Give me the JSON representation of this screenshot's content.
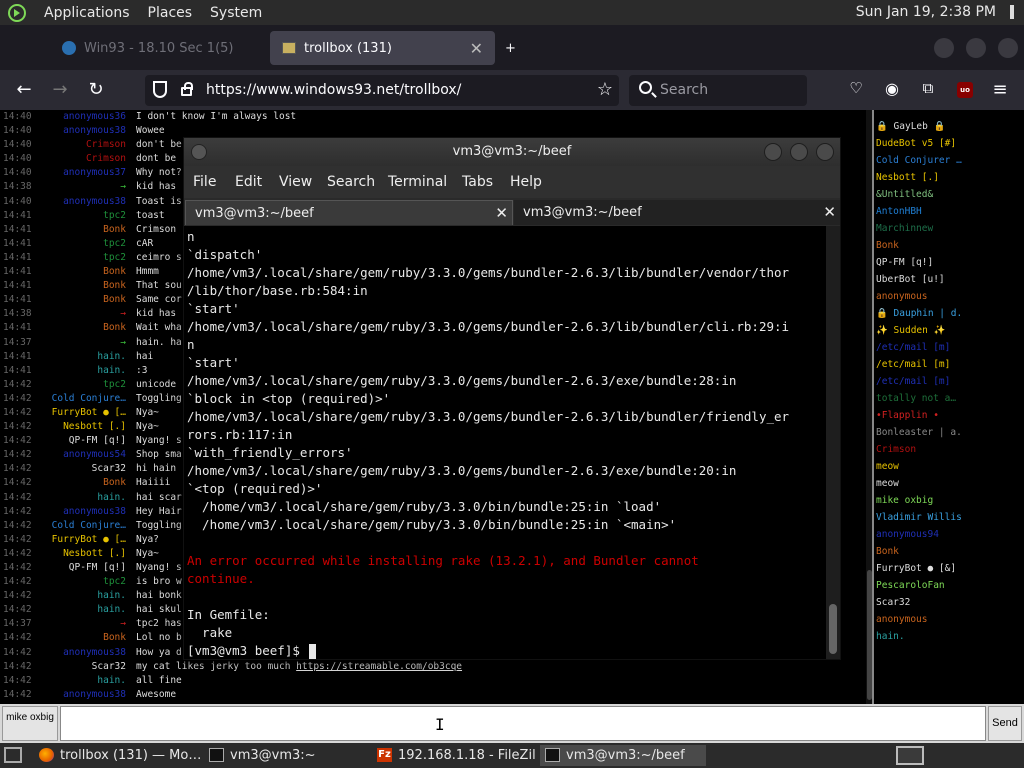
{
  "top_panel": {
    "menus": [
      "Applications",
      "Places",
      "System"
    ],
    "clock": "Sun Jan 19,  2:38 PM"
  },
  "browser": {
    "tabs": [
      {
        "label": "Win93 - 18.10 Sec 1(5)",
        "state": "inactive"
      },
      {
        "label": "trollbox (131)",
        "state": "active"
      }
    ],
    "url": "https://www.windows93.net/trollbox/",
    "search_placeholder": "Search",
    "ublock_label": "uo"
  },
  "chat": {
    "messages": [
      {
        "ts": "14:40",
        "nick": "anonymous36",
        "nick_color": "#1f2fb5",
        "msg": "I don't know I'm always lost"
      },
      {
        "ts": "14:40",
        "nick": "anonymous38",
        "nick_color": "#1f2fb5",
        "msg": "Wowee"
      },
      {
        "ts": "14:40",
        "nick": "Crimson",
        "nick_color": "#b01010",
        "msg": "don't be"
      },
      {
        "ts": "14:40",
        "nick": "Crimson",
        "nick_color": "#b01010",
        "msg": "dont be"
      },
      {
        "ts": "14:40",
        "nick": "anonymous37",
        "nick_color": "#1f2fb5",
        "msg": "Why not?"
      },
      {
        "ts": "14:38",
        "nick": "→",
        "nick_color": "#3cc23c",
        "msg": "kid has"
      },
      {
        "ts": "14:40",
        "nick": "anonymous38",
        "nick_color": "#1f2fb5",
        "msg": "Toast is"
      },
      {
        "ts": "14:41",
        "nick": "tpc2",
        "nick_color": "#1e8f3a",
        "msg": "toast"
      },
      {
        "ts": "14:41",
        "nick": "Bonk",
        "nick_color": "#c8641e",
        "msg": "Crimson"
      },
      {
        "ts": "14:41",
        "nick": "tpc2",
        "nick_color": "#1e8f3a",
        "msg": "cAR"
      },
      {
        "ts": "14:41",
        "nick": "tpc2",
        "nick_color": "#1e8f3a",
        "msg": "ceimro s"
      },
      {
        "ts": "14:41",
        "nick": "Bonk",
        "nick_color": "#c8641e",
        "msg": "Hmmm"
      },
      {
        "ts": "14:41",
        "nick": "Bonk",
        "nick_color": "#c8641e",
        "msg": "That sou"
      },
      {
        "ts": "14:41",
        "nick": "Bonk",
        "nick_color": "#c8641e",
        "msg": "Same cor"
      },
      {
        "ts": "14:38",
        "nick": "→",
        "nick_color": "#d02020",
        "msg": "kid has"
      },
      {
        "ts": "14:41",
        "nick": "Bonk",
        "nick_color": "#c8641e",
        "msg": "Wait wha"
      },
      {
        "ts": "14:37",
        "nick": "→",
        "nick_color": "#3cc23c",
        "msg": "hain. ha"
      },
      {
        "ts": "14:41",
        "nick": "hain.",
        "nick_color": "#2aa0a0",
        "msg": "hai"
      },
      {
        "ts": "14:41",
        "nick": "hain.",
        "nick_color": "#2aa0a0",
        "msg": ":3"
      },
      {
        "ts": "14:42",
        "nick": "tpc2",
        "nick_color": "#1e8f3a",
        "msg": "unicode"
      },
      {
        "ts": "14:42",
        "nick": "Cold Conjure…",
        "nick_color": "#2b7fd4",
        "msg": "Toggling"
      },
      {
        "ts": "14:42",
        "nick": "FurryBot ● […",
        "nick_color": "#e6c200",
        "msg": "Nya~"
      },
      {
        "ts": "14:42",
        "nick": "Nesbott [.]",
        "nick_color": "#e6c200",
        "msg": "Nya~"
      },
      {
        "ts": "14:42",
        "nick": "QP-FM [q!]",
        "nick_color": "#dddddd",
        "msg": "Nyang! s"
      },
      {
        "ts": "14:42",
        "nick": "anonymous54",
        "nick_color": "#1f2fb5",
        "msg": "Shop sma"
      },
      {
        "ts": "14:42",
        "nick": "Scar32",
        "nick_color": "#dddddd",
        "msg": "hi hain"
      },
      {
        "ts": "14:42",
        "nick": "Bonk",
        "nick_color": "#c8641e",
        "msg": "Haiiii"
      },
      {
        "ts": "14:42",
        "nick": "hain.",
        "nick_color": "#2aa0a0",
        "msg": "hai scar"
      },
      {
        "ts": "14:42",
        "nick": "anonymous38",
        "nick_color": "#1f2fb5",
        "msg": "Hey Hair"
      },
      {
        "ts": "14:42",
        "nick": "Cold Conjure…",
        "nick_color": "#2b7fd4",
        "msg": "Toggling"
      },
      {
        "ts": "14:42",
        "nick": "FurryBot ● […",
        "nick_color": "#e6c200",
        "msg": "Nya?"
      },
      {
        "ts": "14:42",
        "nick": "Nesbott [.]",
        "nick_color": "#e6c200",
        "msg": "Nya~"
      },
      {
        "ts": "14:42",
        "nick": "QP-FM [q!]",
        "nick_color": "#dddddd",
        "msg": "Nyang! s"
      },
      {
        "ts": "14:42",
        "nick": "tpc2",
        "nick_color": "#1e8f3a",
        "msg": "is bro w"
      },
      {
        "ts": "14:42",
        "nick": "hain.",
        "nick_color": "#2aa0a0",
        "msg": "hai bonk"
      },
      {
        "ts": "14:42",
        "nick": "hain.",
        "nick_color": "#2aa0a0",
        "msg": "hai skul"
      },
      {
        "ts": "14:37",
        "nick": "→",
        "nick_color": "#d02020",
        "msg": "tpc2 has"
      },
      {
        "ts": "14:42",
        "nick": "Bonk",
        "nick_color": "#c8641e",
        "msg": "Lol no b"
      },
      {
        "ts": "14:42",
        "nick": "anonymous38",
        "nick_color": "#1f2fb5",
        "msg": "How ya d"
      },
      {
        "ts": "14:42",
        "nick": "Scar32",
        "nick_color": "#dddddd",
        "msg": "my cat likes jerky too much ",
        "link": "https://streamable.com/ob3cqe"
      },
      {
        "ts": "14:42",
        "nick": "hain.",
        "nick_color": "#2aa0a0",
        "msg": "all fine"
      },
      {
        "ts": "14:42",
        "nick": "anonymous38",
        "nick_color": "#1f2fb5",
        "msg": "Awesome"
      }
    ],
    "nick_button": "mike oxbig",
    "send_label": "Send"
  },
  "users": [
    {
      "name": "🔒 GayLeb 🔒",
      "color": "#dddddd"
    },
    {
      "name": "DudeBot v5 [#]",
      "color": "#e6c200"
    },
    {
      "name": "Cold Conjurer …",
      "color": "#2b7fd4"
    },
    {
      "name": "Nesbott [.]",
      "color": "#e6c200"
    },
    {
      "name": "&Untitled&",
      "color": "#7fbf7f"
    },
    {
      "name": "AntonHBH",
      "color": "#1f7fd4"
    },
    {
      "name": "Marchinnew",
      "color": "#1e6f4a"
    },
    {
      "name": "Bonk",
      "color": "#c8641e"
    },
    {
      "name": "QP-FM [q!]",
      "color": "#dddddd"
    },
    {
      "name": "UberBot [u!]",
      "color": "#dddddd"
    },
    {
      "name": "anonymous",
      "color": "#c8641e"
    },
    {
      "name": "🔒 Dauphin | d.",
      "color": "#3aa0e0"
    },
    {
      "name": "✨ Sudden ✨",
      "color": "#e6c200"
    },
    {
      "name": "/etc/mail [m]",
      "color": "#1f2fb5"
    },
    {
      "name": "/etc/mail [m]",
      "color": "#e6c200"
    },
    {
      "name": "/etc/mail [m]",
      "color": "#1f2fb5"
    },
    {
      "name": "totally not a…",
      "color": "#1e6f3a"
    },
    {
      "name": "•Flapplin •",
      "color": "#d02020"
    },
    {
      "name": "Bonleaster | a.",
      "color": "#888888"
    },
    {
      "name": "Crimson",
      "color": "#b01010"
    },
    {
      "name": "meow",
      "color": "#e6c200"
    },
    {
      "name": "meow",
      "color": "#dddddd"
    },
    {
      "name": "mike oxbig",
      "color": "#7ed957"
    },
    {
      "name": "Vladimir Willis",
      "color": "#3aa0e0"
    },
    {
      "name": "anonymous94",
      "color": "#1f2fb5"
    },
    {
      "name": "Bonk",
      "color": "#c8641e"
    },
    {
      "name": "FurryBot ● [&]",
      "color": "#dddddd"
    },
    {
      "name": "PescaroloFan",
      "color": "#7ed957"
    },
    {
      "name": "Scar32",
      "color": "#dddddd"
    },
    {
      "name": "anonymous",
      "color": "#c8641e"
    },
    {
      "name": "hain.",
      "color": "#2aa0a0"
    }
  ],
  "terminal": {
    "title": "vm3@vm3:~/beef",
    "menu": [
      "File",
      "Edit",
      "View",
      "Search",
      "Terminal",
      "Tabs",
      "Help"
    ],
    "tabs": [
      "vm3@vm3:~/beef",
      "vm3@vm3:~/beef"
    ],
    "lines": [
      {
        "text": "n",
        "kind": "normal"
      },
      {
        "text": "`dispatch'",
        "kind": "normal"
      },
      {
        "text": "/home/vm3/.local/share/gem/ruby/3.3.0/gems/bundler-2.6.3/lib/bundler/vendor/thor",
        "kind": "normal"
      },
      {
        "text": "/lib/thor/base.rb:584:in",
        "kind": "normal"
      },
      {
        "text": "`start'",
        "kind": "normal"
      },
      {
        "text": "/home/vm3/.local/share/gem/ruby/3.3.0/gems/bundler-2.6.3/lib/bundler/cli.rb:29:i",
        "kind": "normal"
      },
      {
        "text": "n",
        "kind": "normal"
      },
      {
        "text": "`start'",
        "kind": "normal"
      },
      {
        "text": "/home/vm3/.local/share/gem/ruby/3.3.0/gems/bundler-2.6.3/exe/bundle:28:in",
        "kind": "normal"
      },
      {
        "text": "`block in <top (required)>'",
        "kind": "normal"
      },
      {
        "text": "/home/vm3/.local/share/gem/ruby/3.3.0/gems/bundler-2.6.3/lib/bundler/friendly_er",
        "kind": "normal"
      },
      {
        "text": "rors.rb:117:in",
        "kind": "normal"
      },
      {
        "text": "`with_friendly_errors'",
        "kind": "normal"
      },
      {
        "text": "/home/vm3/.local/share/gem/ruby/3.3.0/gems/bundler-2.6.3/exe/bundle:20:in",
        "kind": "normal"
      },
      {
        "text": "`<top (required)>'",
        "kind": "normal"
      },
      {
        "text": "  /home/vm3/.local/share/gem/ruby/3.3.0/bin/bundle:25:in `load'",
        "kind": "normal"
      },
      {
        "text": "  /home/vm3/.local/share/gem/ruby/3.3.0/bin/bundle:25:in `<main>'",
        "kind": "normal"
      },
      {
        "text": "",
        "kind": "normal"
      },
      {
        "text": "An error occurred while installing rake (13.2.1), and Bundler cannot",
        "kind": "err"
      },
      {
        "text": "continue.",
        "kind": "err"
      },
      {
        "text": "",
        "kind": "normal"
      },
      {
        "text": "In Gemfile:",
        "kind": "normal"
      },
      {
        "text": "  rake",
        "kind": "normal"
      }
    ],
    "prompt": "[vm3@vm3 beef]$ "
  },
  "taskbar": {
    "tasks": [
      {
        "label": "trollbox (131) — Mo…",
        "icon": "firefox-icon",
        "active": false
      },
      {
        "label": "vm3@vm3:~",
        "icon": "terminal-icon",
        "active": false
      },
      {
        "label": "192.168.1.18 - FileZilla",
        "icon": "filezilla-icon",
        "active": false
      },
      {
        "label": "vm3@vm3:~/beef",
        "icon": "terminal-icon",
        "active": true
      }
    ],
    "filezilla_glyph": "Fz"
  }
}
